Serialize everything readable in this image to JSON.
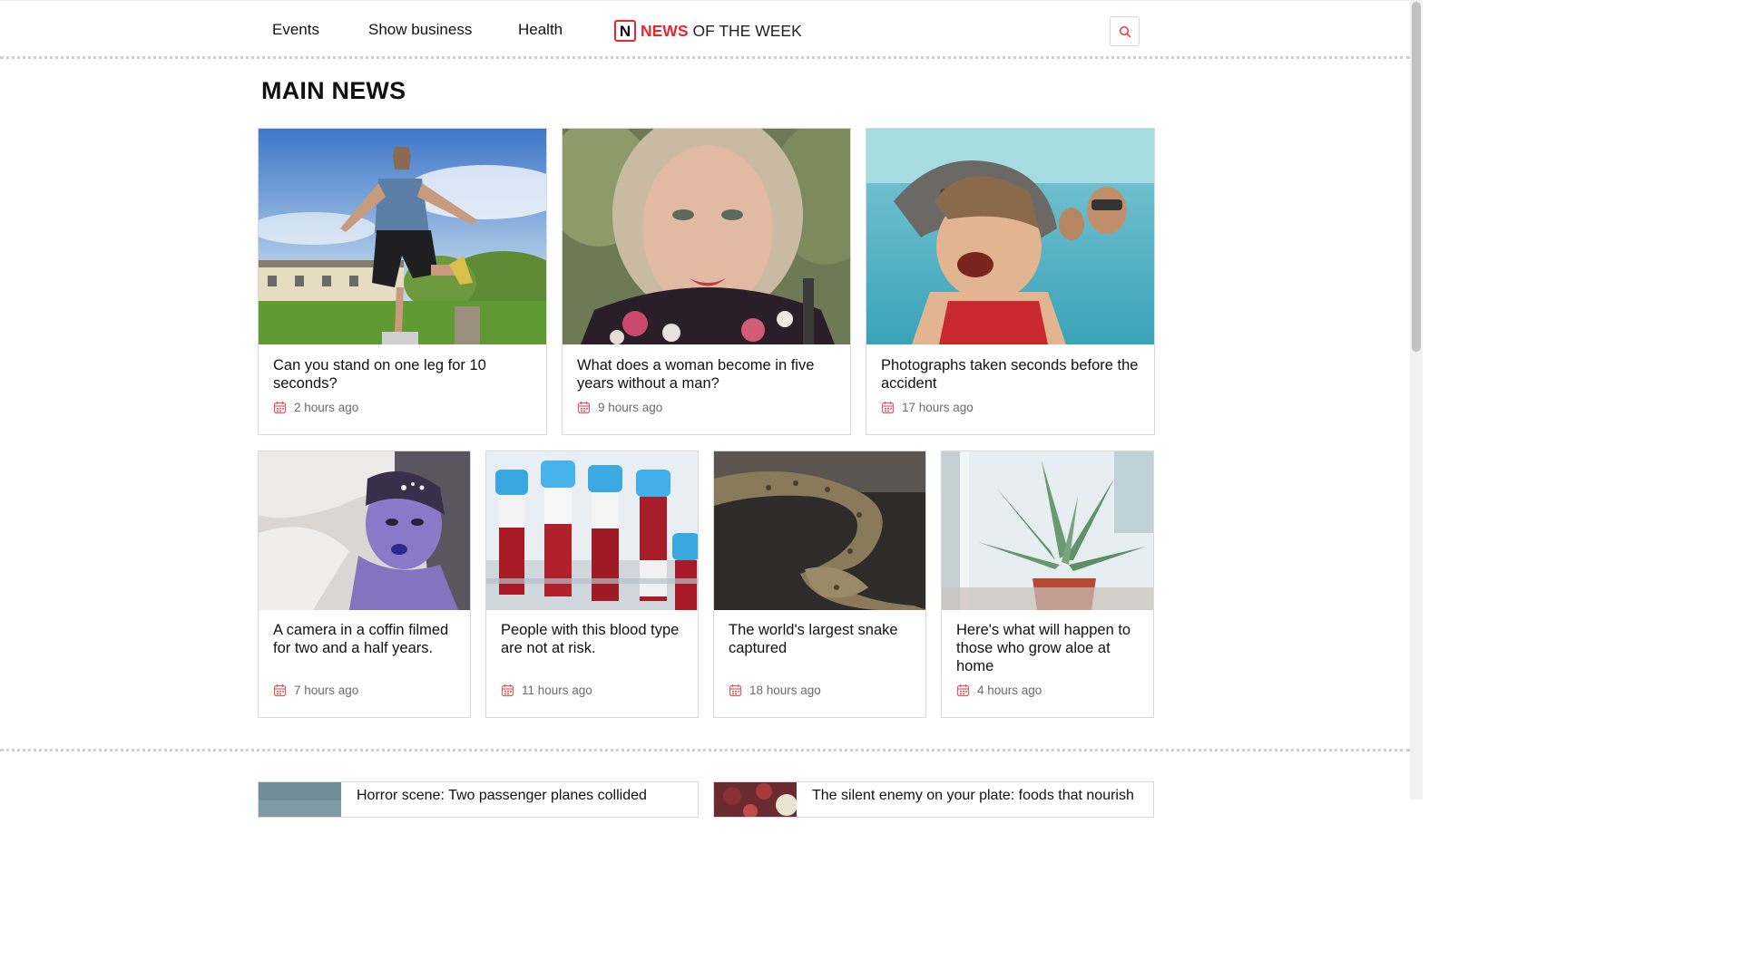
{
  "header": {
    "nav": [
      {
        "label": "Events"
      },
      {
        "label": "Show business"
      },
      {
        "label": "Health"
      }
    ],
    "logo": {
      "mark": "N",
      "highlight": "NEWS",
      "rest": "OF THE WEEK"
    },
    "search_icon": "search-icon"
  },
  "main": {
    "title": "MAIN NEWS",
    "top_articles": [
      {
        "title": "Can you stand on one leg for 10 seconds?",
        "time": "2 hours ago",
        "image": "man balancing on one leg on a wooden post"
      },
      {
        "title": "What does a woman become in five years without a man?",
        "time": "9 hours ago",
        "image": "portrait of a smiling woman"
      },
      {
        "title": "Photographs taken seconds before the accident",
        "time": "17 hours ago",
        "image": "woman screaming in the sea with a seal"
      }
    ],
    "grid_articles": [
      {
        "title": "A camera in a coffin filmed for two and a half years.",
        "time": "7 hours ago",
        "image": "woman with purple makeup lying in a coffin"
      },
      {
        "title": "People with this blood type are not at risk.",
        "time": "11 hours ago",
        "image": "blood sample tubes with blue caps"
      },
      {
        "title": "The world's largest snake captured",
        "time": "18 hours ago",
        "image": "large python on a dark surface"
      },
      {
        "title": "Here's what will happen to those who grow aloe at home",
        "time": "4 hours ago",
        "image": "aloe plant by a window"
      }
    ],
    "bottom_articles": [
      {
        "title": "Horror scene: Two passenger planes collided"
      },
      {
        "title": "The silent enemy on your plate: foods that nourish"
      }
    ]
  },
  "colors": {
    "accent": "#e8262e",
    "meta_icon": "#e25a62",
    "border": "#d9d9d9",
    "muted_text": "#6b6b6b"
  },
  "icons": {
    "date": "calendar-icon"
  }
}
